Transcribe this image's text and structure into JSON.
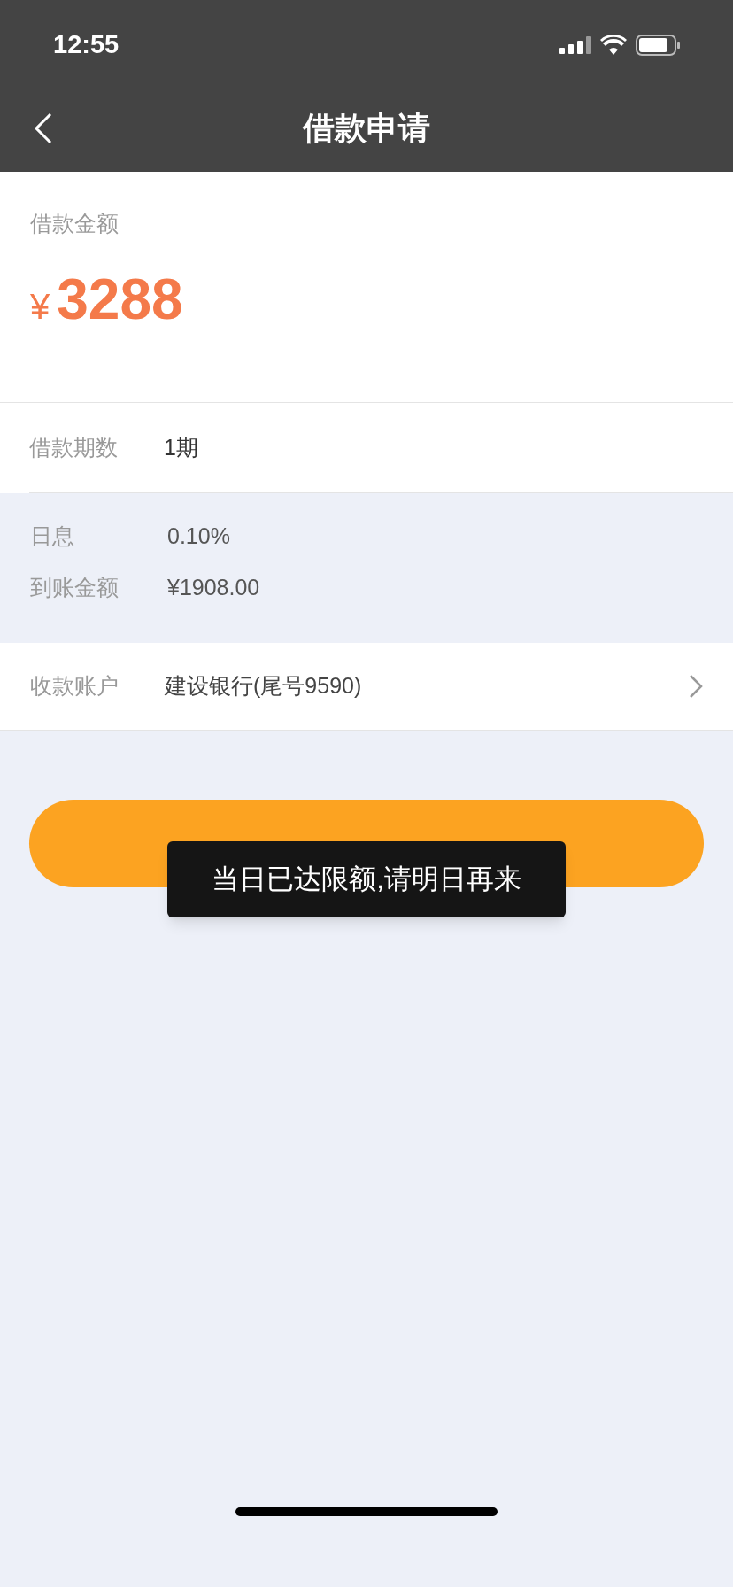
{
  "status_bar": {
    "time": "12:55"
  },
  "nav": {
    "title": "借款申请"
  },
  "amount": {
    "label": "借款金额",
    "currency": "¥",
    "value": "3288"
  },
  "term": {
    "label": "借款期数",
    "value": "1期"
  },
  "details": [
    {
      "label": "日息",
      "value": "0.10%"
    },
    {
      "label": "到账金额",
      "value": "¥1908.00"
    }
  ],
  "account": {
    "label": "收款账户",
    "value": "建设银行(尾号9590)"
  },
  "toast": {
    "text": "当日已达限额,请明日再来"
  }
}
